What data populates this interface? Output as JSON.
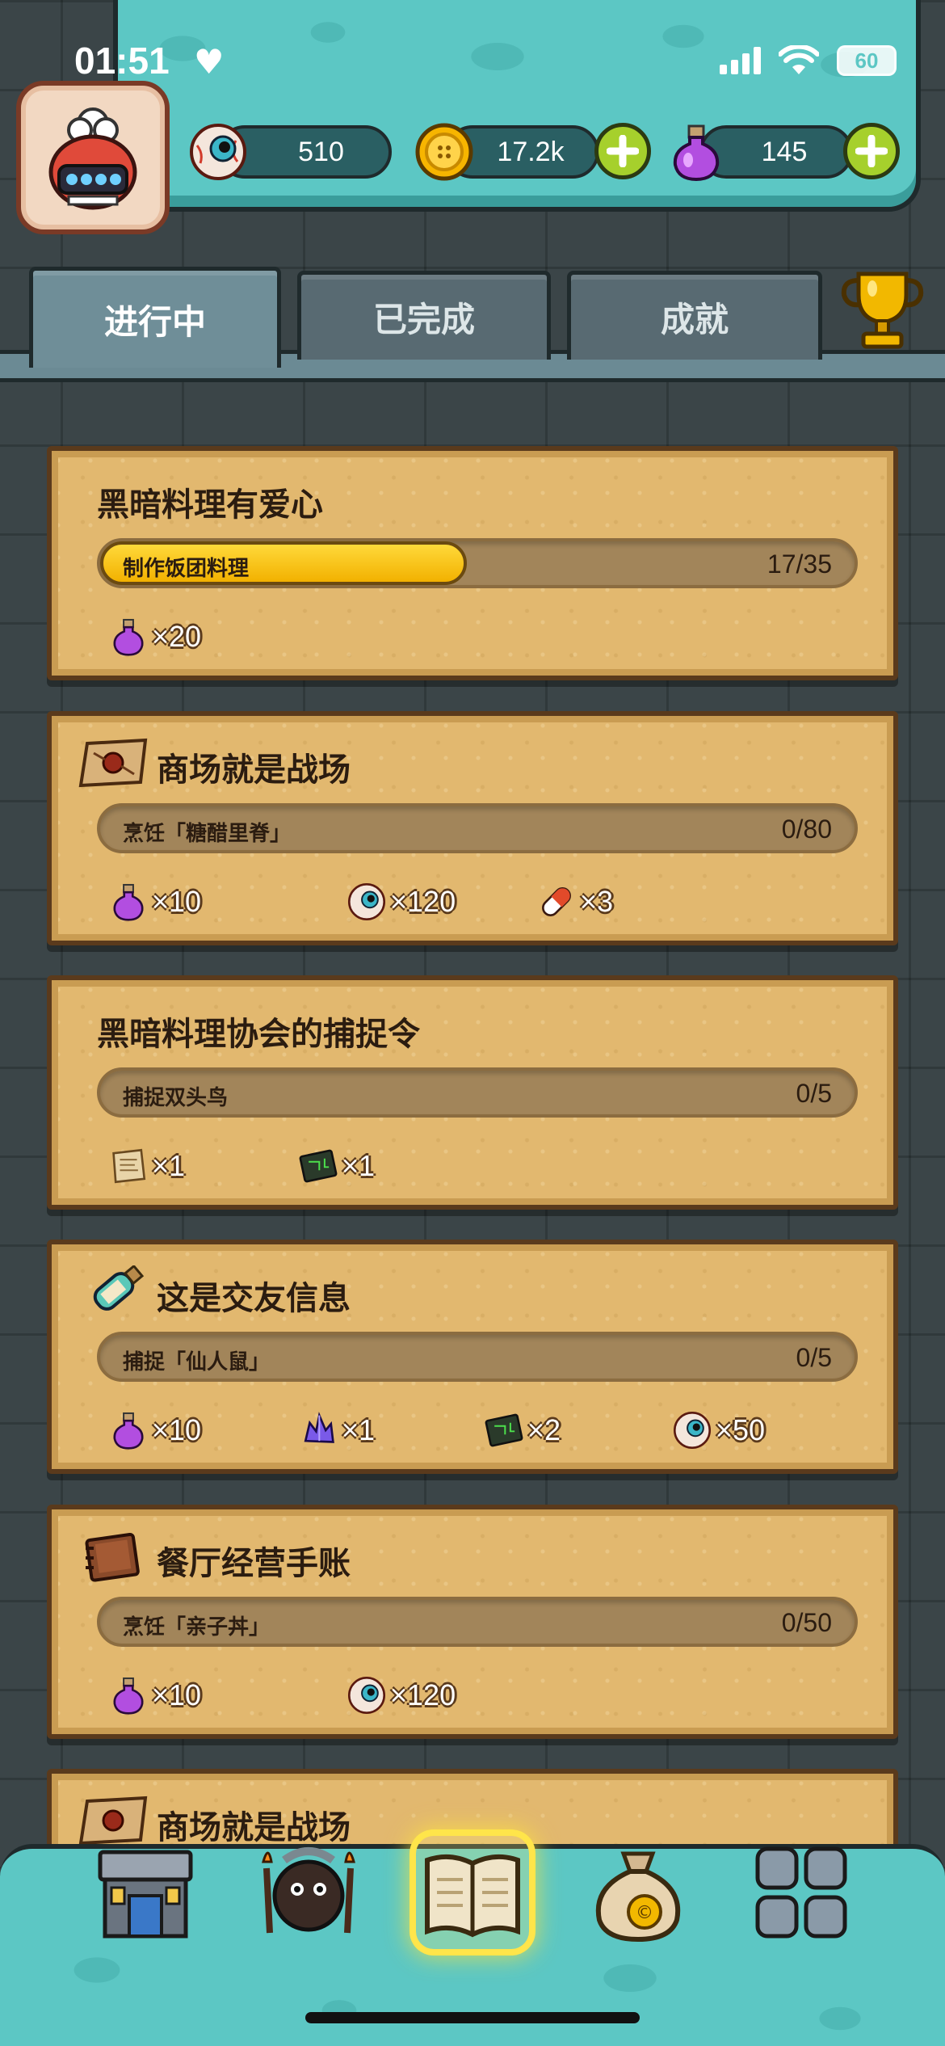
{
  "status_bar": {
    "time": "01:51",
    "battery": "60"
  },
  "resources": {
    "eyeballs": "510",
    "coins": "17.2k",
    "potions": "145"
  },
  "tabs": [
    {
      "label": "进行中",
      "active": true
    },
    {
      "label": "已完成",
      "active": false
    },
    {
      "label": "成就",
      "active": false
    }
  ],
  "quests": [
    {
      "title": "黑暗料理有爱心",
      "icon": null,
      "task": "制作饭团料理",
      "progress": "17/35",
      "progress_fraction": 0.486,
      "rewards": [
        {
          "icon": "potion-icon",
          "amount": "×20"
        }
      ]
    },
    {
      "title": "商场就是战场",
      "icon": "map-scroll-icon",
      "task": "烹饪「糖醋里脊」",
      "progress": "0/80",
      "progress_fraction": 0,
      "rewards": [
        {
          "icon": "potion-icon",
          "amount": "×10"
        },
        {
          "icon": "eyeball-icon",
          "amount": "×120"
        },
        {
          "icon": "pill-capsule-icon",
          "amount": "×3"
        }
      ]
    },
    {
      "title": "黑暗料理协会的捕捉令",
      "icon": null,
      "task": "捕捉双头鸟",
      "progress": "0/5",
      "progress_fraction": 0,
      "rewards": [
        {
          "icon": "parchment-icon",
          "amount": "×1"
        },
        {
          "icon": "circuit-chip-icon",
          "amount": "×1"
        }
      ]
    },
    {
      "title": "这是交友信息",
      "icon": "message-bottle-icon",
      "task": "捕捉「仙人鼠」",
      "progress": "0/5",
      "progress_fraction": 0,
      "rewards": [
        {
          "icon": "potion-icon",
          "amount": "×10"
        },
        {
          "icon": "crystal-icon",
          "amount": "×1"
        },
        {
          "icon": "circuit-chip-icon",
          "amount": "×2"
        },
        {
          "icon": "eyeball-icon",
          "amount": "×50"
        }
      ]
    },
    {
      "title": "餐厅经营手账",
      "icon": "ledger-book-icon",
      "task": "烹饪「亲子丼」",
      "progress": "0/50",
      "progress_fraction": 0,
      "rewards": [
        {
          "icon": "potion-icon",
          "amount": "×10"
        },
        {
          "icon": "eyeball-icon",
          "amount": "×120"
        }
      ]
    },
    {
      "title": "商场就是战场",
      "icon": "map-scroll-icon",
      "task": "",
      "progress": "",
      "progress_fraction": 0,
      "rewards": []
    }
  ],
  "colors": {
    "accent_teal": "#5cc7c4",
    "parchment": "#e2b86f",
    "progress_yellow": "#ffd93a",
    "plus_green": "#a6d02c"
  }
}
